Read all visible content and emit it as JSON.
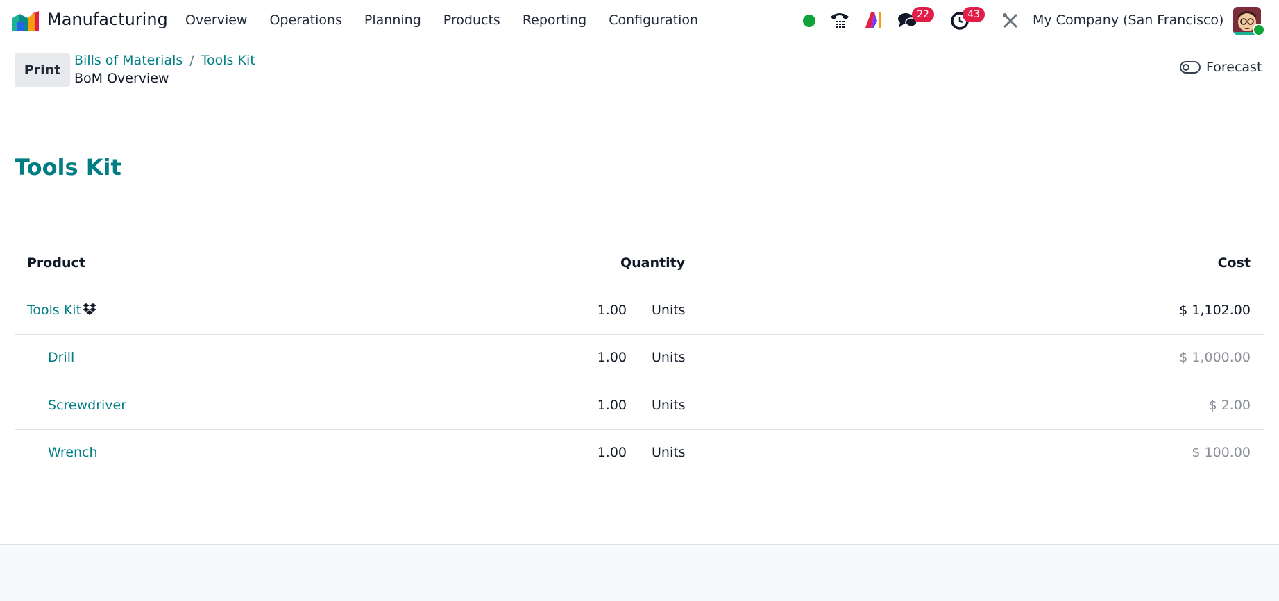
{
  "app": {
    "name": "Manufacturing",
    "logo_icon": "manufacturing-app-icon"
  },
  "menu": [
    {
      "label": "Overview"
    },
    {
      "label": "Operations"
    },
    {
      "label": "Planning"
    },
    {
      "label": "Products"
    },
    {
      "label": "Reporting"
    },
    {
      "label": "Configuration"
    }
  ],
  "systray": {
    "chat_count": "22",
    "activity_count": "43",
    "company": "My Company (San Francisco)",
    "presence_color": "#10a33a",
    "badge_color": "#e11d48"
  },
  "control": {
    "print_label": "Print",
    "breadcrumb": [
      {
        "label": "Bills of Materials"
      },
      {
        "label": "Tools Kit"
      }
    ],
    "breadcrumb_sep": "/",
    "view_title": "BoM Overview",
    "forecast_label": "Forecast"
  },
  "report": {
    "title": "Tools Kit",
    "headers": {
      "product": "Product",
      "quantity": "Quantity",
      "cost": "Cost"
    },
    "rows": [
      {
        "product": "Tools Kit",
        "qty": "1.00",
        "uom": "Units",
        "cost": "$ 1,102.00"
      },
      {
        "product": "Drill",
        "qty": "1.00",
        "uom": "Units",
        "cost": "$ 1,000.00"
      },
      {
        "product": "Screwdriver",
        "qty": "1.00",
        "uom": "Units",
        "cost": "$ 2.00"
      },
      {
        "product": "Wrench",
        "qty": "1.00",
        "uom": "Units",
        "cost": "$ 100.00"
      }
    ]
  },
  "colors": {
    "accent": "#017e84",
    "muted_cost": "#8a8f98"
  }
}
